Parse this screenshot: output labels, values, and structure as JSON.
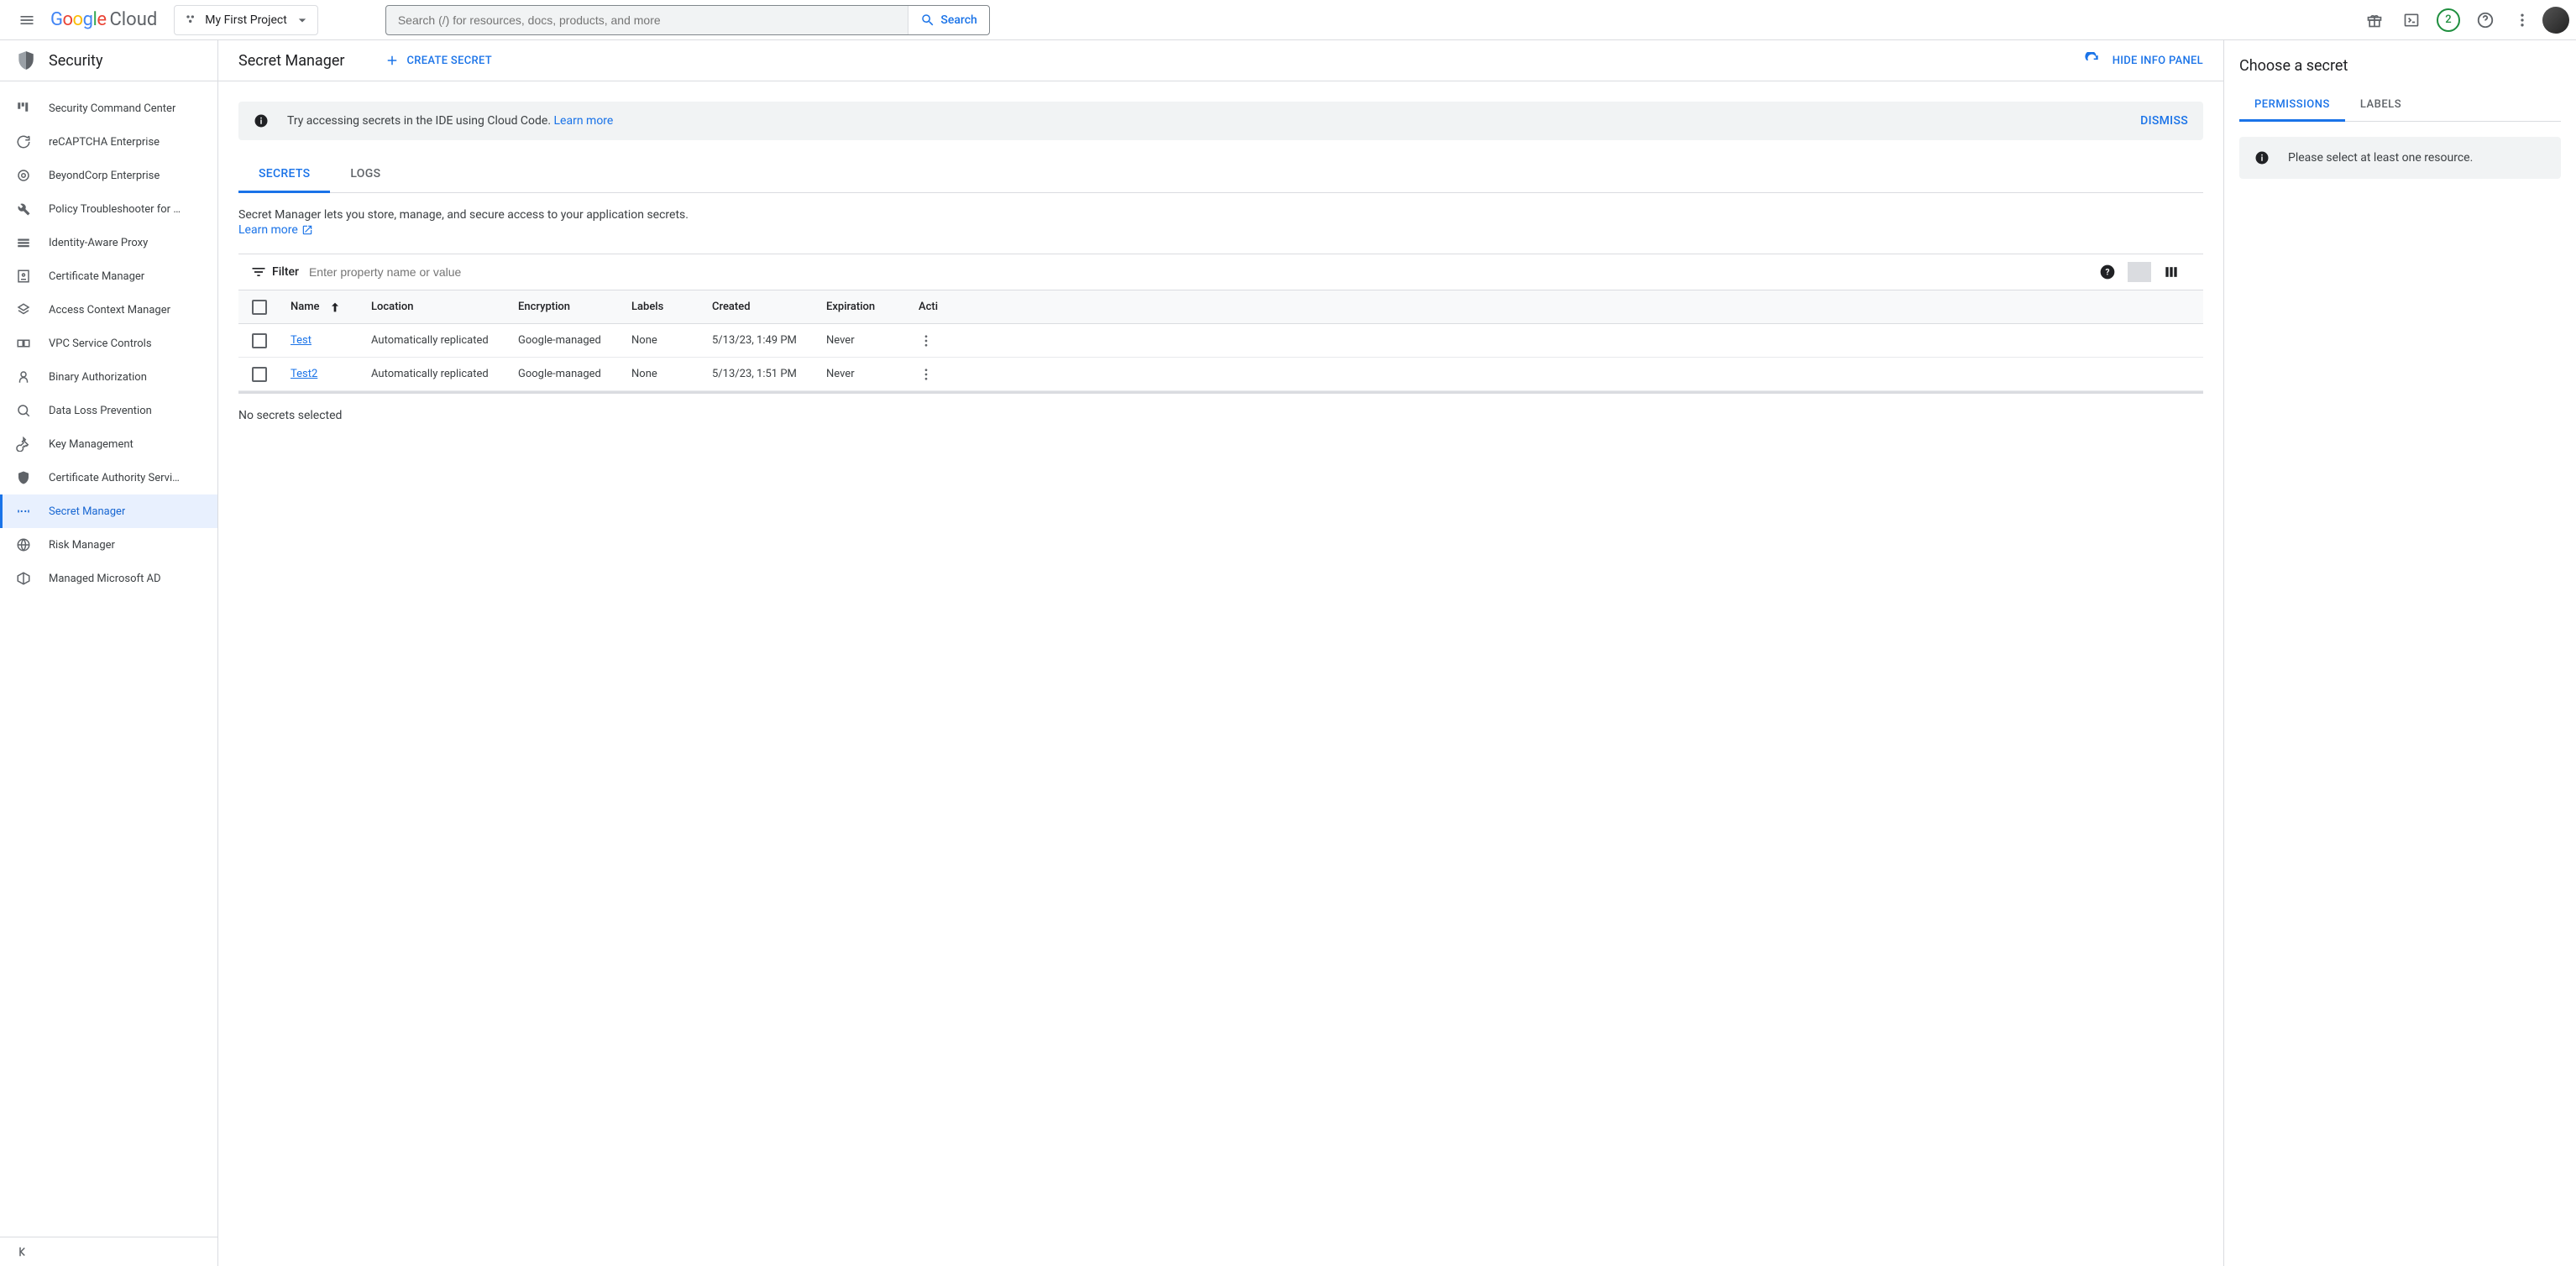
{
  "header": {
    "logo_text": "Google",
    "logo_suffix": "Cloud",
    "project_name": "My First Project",
    "search_placeholder": "Search (/) for resources, docs, products, and more",
    "search_button": "Search",
    "trial_badge": "2"
  },
  "sidebar": {
    "title": "Security",
    "items": [
      {
        "label": "Security Command Center",
        "icon": "dashboard"
      },
      {
        "label": "reCAPTCHA Enterprise",
        "icon": "recaptcha"
      },
      {
        "label": "BeyondCorp Enterprise",
        "icon": "beyondcorp"
      },
      {
        "label": "Policy Troubleshooter for …",
        "icon": "wrench"
      },
      {
        "label": "Identity-Aware Proxy",
        "icon": "iap"
      },
      {
        "label": "Certificate Manager",
        "icon": "cert"
      },
      {
        "label": "Access Context Manager",
        "icon": "acm"
      },
      {
        "label": "VPC Service Controls",
        "icon": "vpc"
      },
      {
        "label": "Binary Authorization",
        "icon": "binauth"
      },
      {
        "label": "Data Loss Prevention",
        "icon": "dlp"
      },
      {
        "label": "Key Management",
        "icon": "key"
      },
      {
        "label": "Certificate Authority Servi…",
        "icon": "ca"
      },
      {
        "label": "Secret Manager",
        "icon": "secret",
        "active": true
      },
      {
        "label": "Risk Manager",
        "icon": "risk"
      },
      {
        "label": "Managed Microsoft AD",
        "icon": "ad"
      }
    ]
  },
  "main": {
    "page_title": "Secret Manager",
    "create_button": "CREATE SECRET",
    "hide_panel": "HIDE INFO PANEL",
    "banner": {
      "text": "Try accessing secrets in the IDE using Cloud Code. ",
      "link": "Learn more",
      "dismiss": "DISMISS"
    },
    "tabs": [
      {
        "label": "SECRETS",
        "active": true
      },
      {
        "label": "LOGS",
        "active": false
      }
    ],
    "description": "Secret Manager lets you store, manage, and secure access to your application secrets.",
    "learn_more": "Learn more",
    "filter": {
      "label": "Filter",
      "placeholder": "Enter property name or value"
    },
    "columns": {
      "name": "Name",
      "location": "Location",
      "encryption": "Encryption",
      "labels": "Labels",
      "created": "Created",
      "expiration": "Expiration",
      "actions": "Acti"
    },
    "rows": [
      {
        "name": "Test",
        "location": "Automatically replicated",
        "encryption": "Google-managed",
        "labels": "None",
        "created": "5/13/23, 1:49 PM",
        "expiration": "Never"
      },
      {
        "name": "Test2",
        "location": "Automatically replicated",
        "encryption": "Google-managed",
        "labels": "None",
        "created": "5/13/23, 1:51 PM",
        "expiration": "Never"
      }
    ],
    "selection_status": "No secrets selected"
  },
  "info_panel": {
    "title": "Choose a secret",
    "tabs": [
      {
        "label": "PERMISSIONS",
        "active": true
      },
      {
        "label": "LABELS",
        "active": false
      }
    ],
    "message": "Please select at least one resource."
  }
}
